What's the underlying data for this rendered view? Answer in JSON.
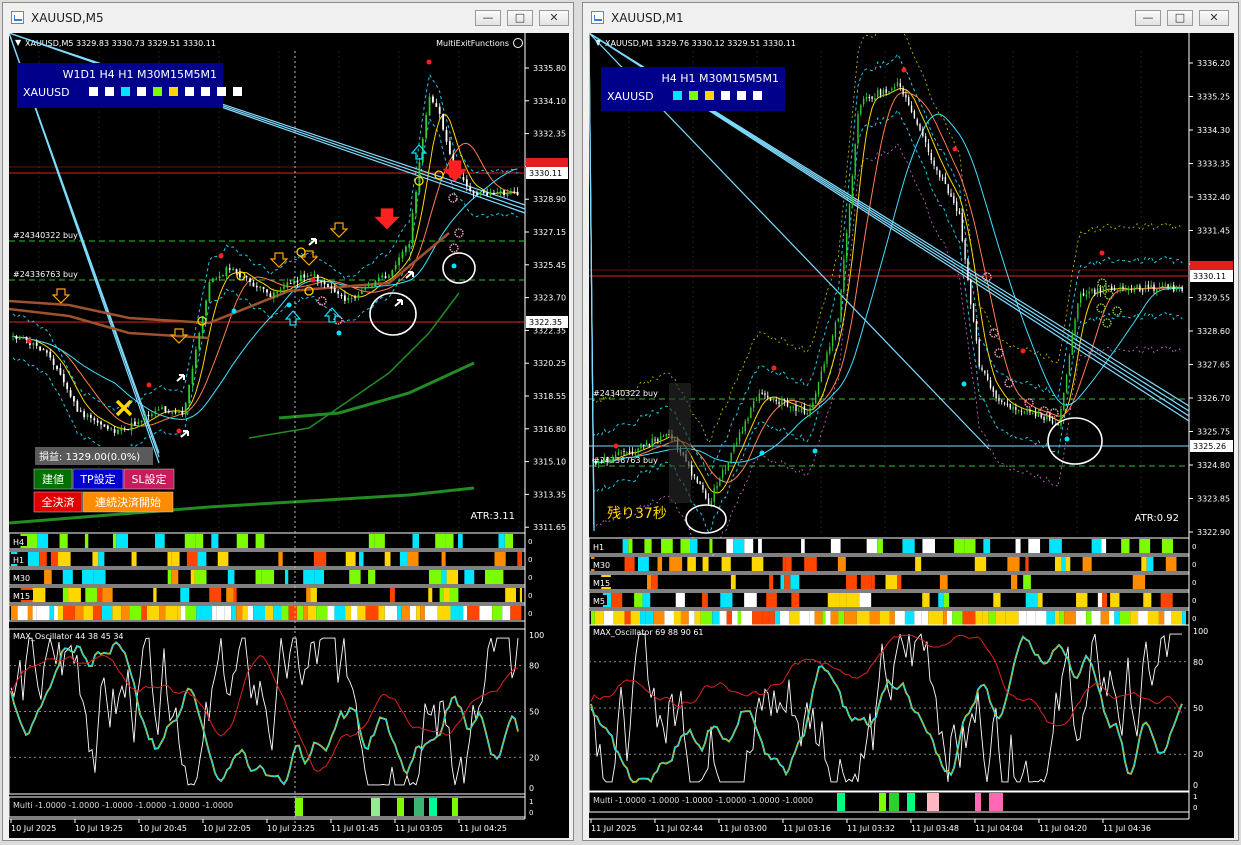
{
  "left": {
    "title": "XAUUSD,M5",
    "chart_label": "XAUUSD,M5  3329.83 3330.73 3329.51 3330.11",
    "ea_name": "MultiExitFunctions",
    "panel_tf": "W1D1 H4 H1 M30M15M5M1",
    "panel_symbol": "XAUUSD",
    "price_levels": [
      "3335.80",
      "3334.10",
      "3332.35",
      "3330.60",
      "3328.90",
      "3327.15",
      "3325.45",
      "3323.70",
      "3322.35",
      "3320.25",
      "3318.55",
      "3316.80",
      "3315.10",
      "3313.35",
      "3311.65"
    ],
    "current_price": "3330.11",
    "sl_price": "3322.35",
    "order1": "#24340322 buy",
    "order2": "#24336763 buy",
    "atr": "ATR:3.11",
    "profit": "損益: 1329.00(0.0%)",
    "btn_entry": "建値",
    "btn_tp": "TP設定",
    "btn_sl": "SL設定",
    "btn_close_all": "全決済",
    "btn_continuous": "連続決済開始",
    "strip_labels": [
      "H4",
      "H1",
      "M30",
      "M15"
    ],
    "osc_label": "MAX_Oscillator 44 38 45 34",
    "osc_levels": [
      "100",
      "80",
      "50",
      "20",
      "0"
    ],
    "multi_label": "Multi -1.0000 -1.0000 -1.0000 -1.0000 -1.0000 -1.0000",
    "multi_levels": [
      "1",
      "0"
    ],
    "time_labels": [
      "10 Jul 2025",
      "10 Jul 19:25",
      "10 Jul 20:45",
      "10 Jul 22:05",
      "10 Jul 23:25",
      "11 Jul 01:45",
      "11 Jul 03:05",
      "11 Jul 04:25"
    ]
  },
  "right": {
    "title": "XAUUSD,M1",
    "chart_label": "XAUUSD,M1  3329.76 3330.12 3329.51 3330.11",
    "panel_tf": "H4 H1 M30M15M5M1",
    "panel_symbol": "XAUUSD",
    "price_levels": [
      "3336.20",
      "3335.25",
      "3334.30",
      "3333.35",
      "3332.40",
      "3331.45",
      "3330.50",
      "3329.55",
      "3328.60",
      "3327.65",
      "3326.70",
      "3325.75",
      "3324.80",
      "3323.85",
      "3322.90"
    ],
    "current_price": "3330.11",
    "sl_price": "3325.26",
    "order1": "#24340322 buy",
    "order2": "#24336763 buy",
    "atr": "ATR:0.92",
    "remaining": "残り37秒",
    "strip_labels": [
      "H1",
      "M30",
      "M15",
      "M5"
    ],
    "osc_label": "MAX_Oscillator 69 88 90 61",
    "osc_levels": [
      "100",
      "80",
      "50",
      "20",
      "0"
    ],
    "multi_label": "Multi -1.0000 -1.0000 -1.0000 -1.0000 -1.0000 -1.0000",
    "multi_levels": [
      "1",
      "0"
    ],
    "time_labels": [
      "11 Jul 2025",
      "11 Jul 02:44",
      "11 Jul 03:00",
      "11 Jul 03:16",
      "11 Jul 03:32",
      "11 Jul 03:48",
      "11 Jul 04:04",
      "11 Jul 04:20",
      "11 Jul 04:36"
    ]
  },
  "colors": {
    "bull": "#32cd32",
    "bear": "#ff2020",
    "cyan": "#00e5ff",
    "lime": "#7cfc00",
    "orange": "#ff8c00",
    "yellow": "#ffd700",
    "panel": "#00008b"
  }
}
